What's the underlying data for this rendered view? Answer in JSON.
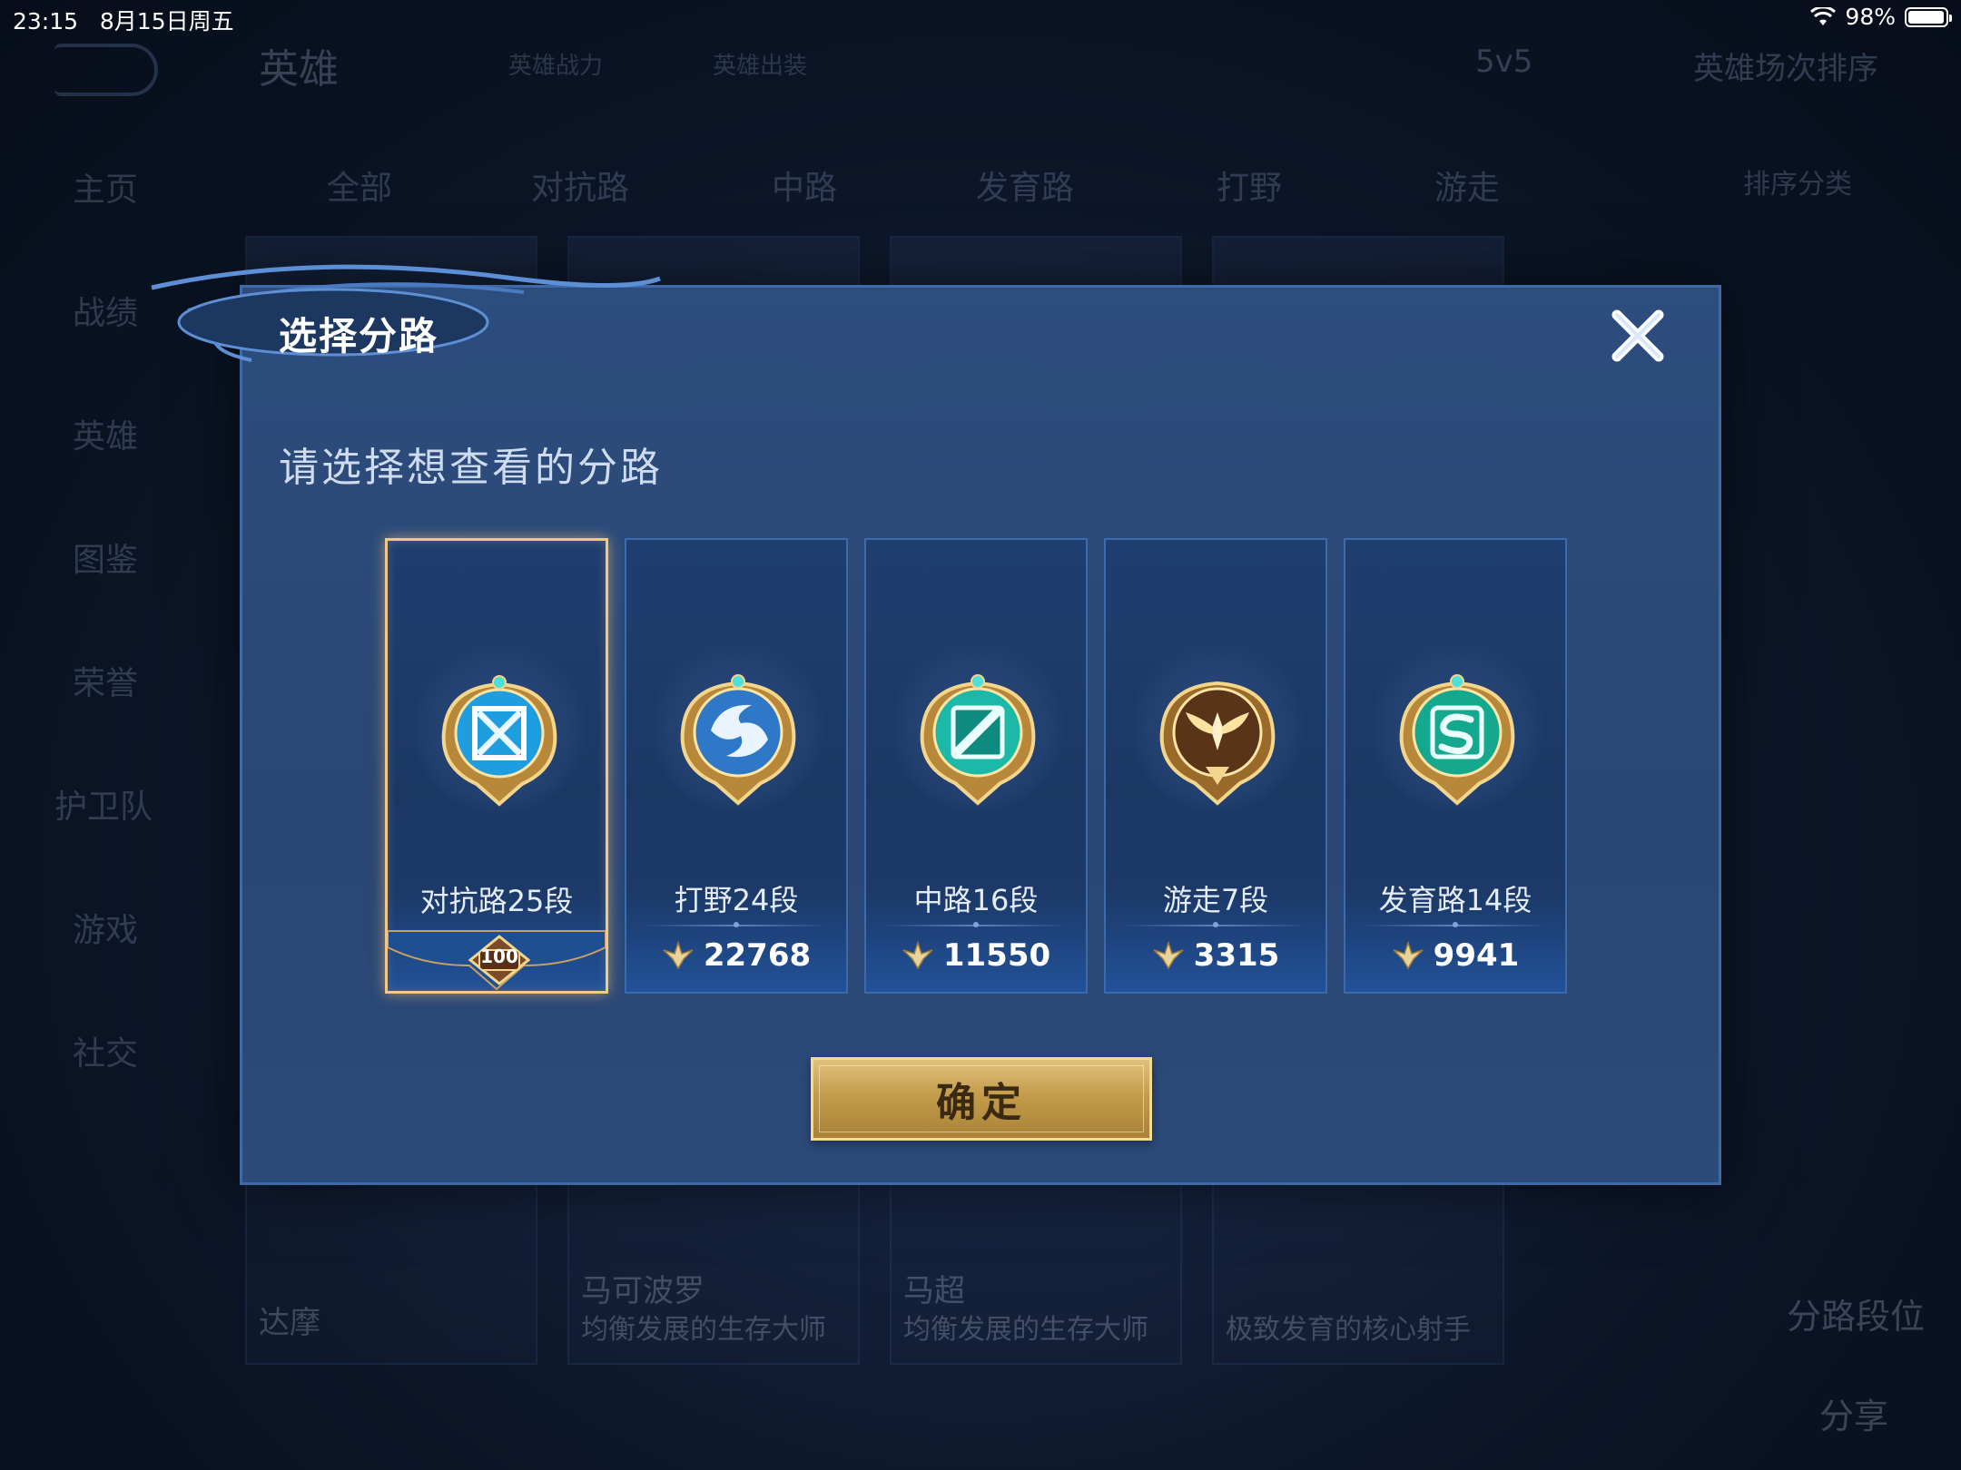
{
  "status_bar": {
    "time": "23:15",
    "date": "8月15日周五",
    "battery": "98%",
    "battery_level": 0.98
  },
  "background": {
    "page_title": "英雄",
    "top_links": [
      "英雄战力",
      "英雄出装"
    ],
    "mode": "5v5",
    "sort": "英雄场次排序",
    "sidebar": [
      "主页",
      "战绩",
      "英雄",
      "图鉴",
      "荣誉",
      "护卫队",
      "游戏",
      "社交"
    ],
    "tabs": [
      "全部",
      "对抗路",
      "中路",
      "发育路",
      "打野",
      "游走"
    ],
    "tab_right": "排序分类",
    "cards": [
      {
        "name": "达摩",
        "desc": ""
      },
      {
        "name": "马可波罗",
        "desc": "均衡发展的生存大师"
      },
      {
        "name": "马超",
        "desc": "均衡发展的生存大师"
      },
      {
        "name": "",
        "desc": "极致发育的核心射手"
      }
    ],
    "right_buttons": [
      "分路段位",
      "分享"
    ]
  },
  "modal": {
    "title": "选择分路",
    "subtitle": "请选择想查看的分路",
    "confirm_label": "确定",
    "lanes": [
      {
        "name": "对抗路25段",
        "badge": "100",
        "selected": true,
        "emblem": "clash-lane-emblem",
        "color": "#2aa6e8"
      },
      {
        "name": "打野24段",
        "score": "22768",
        "selected": false,
        "emblem": "jungle-emblem",
        "color": "#3d8ad6"
      },
      {
        "name": "中路16段",
        "score": "11550",
        "selected": false,
        "emblem": "mid-lane-emblem",
        "color": "#23c9b5"
      },
      {
        "name": "游走7段",
        "score": "3315",
        "selected": false,
        "emblem": "roam-emblem",
        "color": "#c98a33"
      },
      {
        "name": "发育路14段",
        "score": "9941",
        "selected": false,
        "emblem": "farm-lane-emblem",
        "color": "#1fb8a0"
      }
    ]
  },
  "colors": {
    "accent_gold": "#e0c27c",
    "modal_bg": "#2d4d7e",
    "card_bg": "#1f3e70",
    "selected_border": "#f0c88a"
  }
}
